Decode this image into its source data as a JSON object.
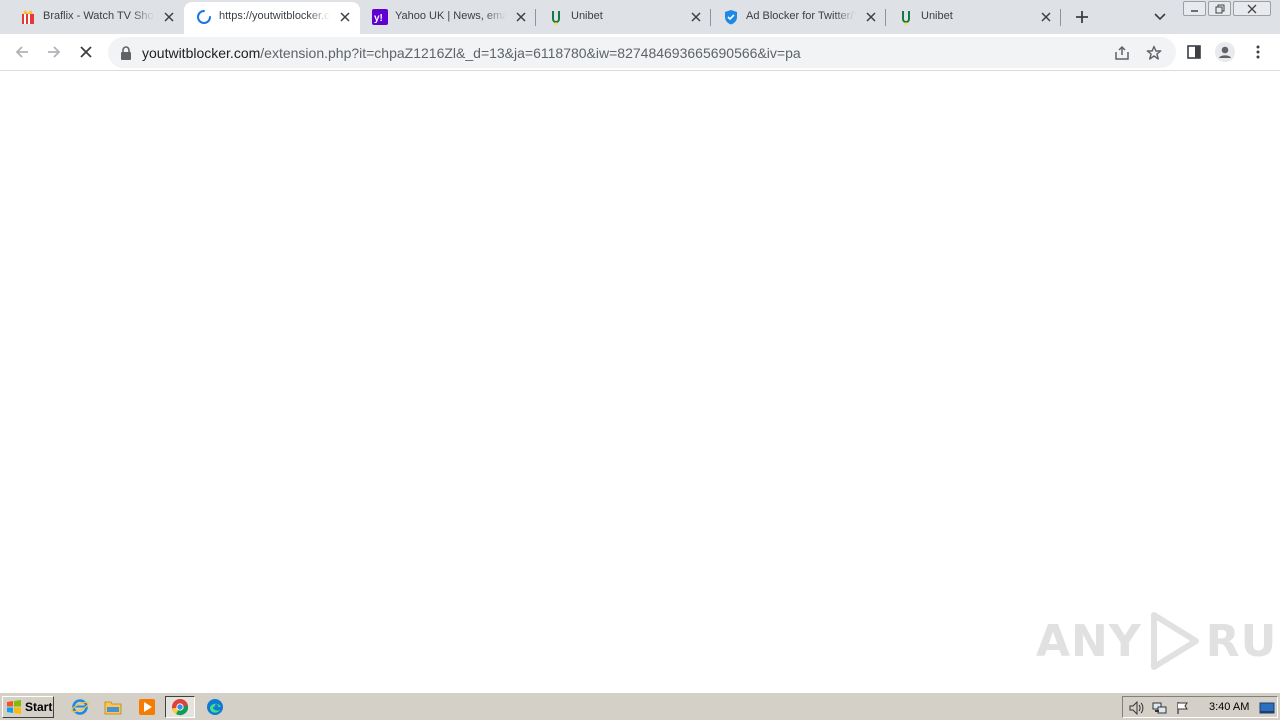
{
  "browser": {
    "tabs": [
      {
        "title": "Braflix - Watch TV Shows",
        "icon": "braflix-icon",
        "active": false
      },
      {
        "title": "https://youtwitblocker.com/",
        "icon": "loading-spinner-icon",
        "active": true
      },
      {
        "title": "Yahoo UK | News, email",
        "icon": "yahoo-icon",
        "active": false
      },
      {
        "title": "Unibet",
        "icon": "unibet-icon",
        "active": false
      },
      {
        "title": "Ad Blocker for Twitter/YouTube",
        "icon": "shield-icon",
        "active": false
      },
      {
        "title": "Unibet",
        "icon": "unibet-icon",
        "active": false
      }
    ],
    "address_bar": {
      "domain": "youtwitblocker.com",
      "path": "/extension.php?it=chpaZ1216Zl&_d=13&ja=6118780&iw=827484693665690566&iv=pa"
    }
  },
  "watermark": {
    "text_left": "ANY",
    "text_right": "RUN"
  },
  "taskbar": {
    "start_label": "Start",
    "clock": "3:40 AM"
  },
  "colors": {
    "tabstrip": "#dee1e6",
    "omnibox": "#f1f3f4",
    "taskbar": "#d4d0c8",
    "yahoo": "#5f01d1",
    "spinner": "#1a73e8"
  }
}
